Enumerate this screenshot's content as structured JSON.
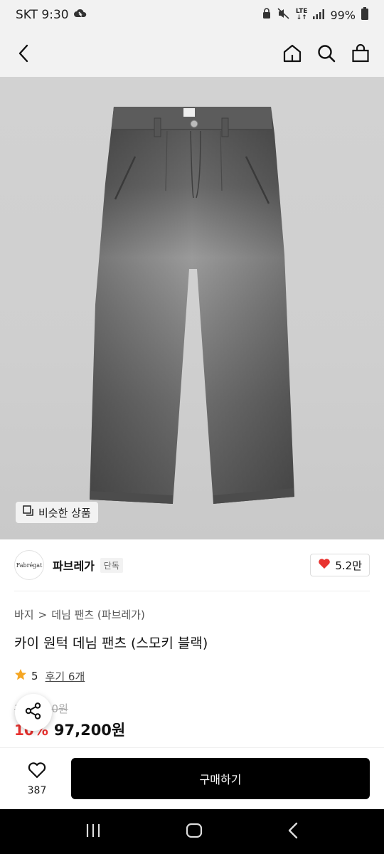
{
  "status_bar": {
    "carrier_time": "SKT 9:30",
    "network_top": "LTE",
    "network_bottom": "↓↑",
    "battery": "99%"
  },
  "header": {
    "icons": [
      "back-arrow-icon",
      "home-icon",
      "search-icon",
      "shopping-bag-icon"
    ]
  },
  "image": {
    "similar_label": "비슷한 상품"
  },
  "brand": {
    "logo_text": "Fabrégat",
    "name": "파브레가",
    "badge": "단독",
    "likes": "5.2만"
  },
  "product": {
    "breadcrumb_category": "바지",
    "breadcrumb_separator": ">",
    "breadcrumb_sub": "데님 팬츠 (파브레가)",
    "title": "카이 원턱 데님 팬츠 (스모키 블랙)",
    "rating": "5",
    "reviews": "후기 6개",
    "original_price": "108,000원",
    "discount": "10%",
    "sale_price": "97,200원"
  },
  "action_bar": {
    "wish_count": "387",
    "buy_label": "구매하기"
  },
  "colors": {
    "accent_red": "#e8322f",
    "heart_red": "#e8322f",
    "star_gold": "#f5a623",
    "button_black": "#000000"
  }
}
